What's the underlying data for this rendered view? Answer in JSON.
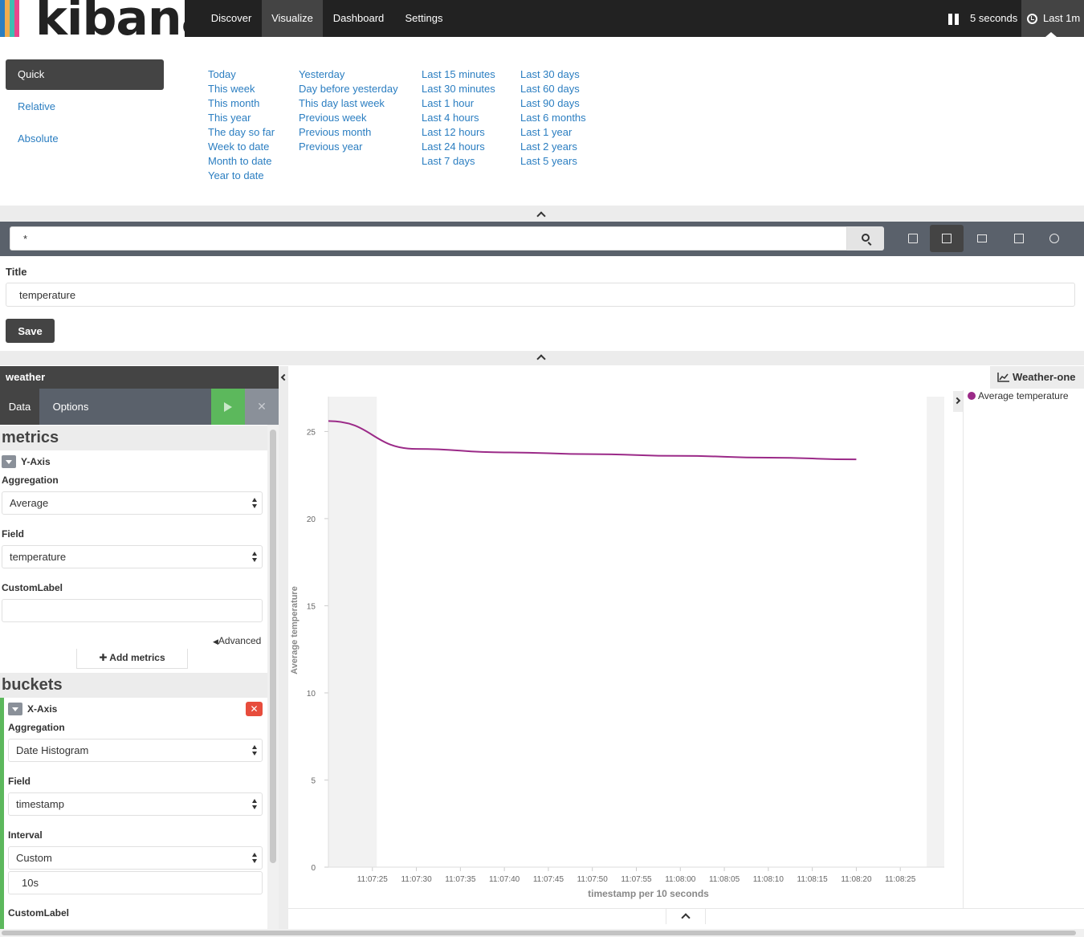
{
  "app": {
    "logo_text": "kibana",
    "logo_colors": [
      "#e8478b",
      "#3ebeb0",
      "#f0ad4e",
      "#2b7ec1"
    ]
  },
  "nav": {
    "items": [
      {
        "label": "Discover",
        "active": false
      },
      {
        "label": "Visualize",
        "active": true
      },
      {
        "label": "Dashboard",
        "active": false
      },
      {
        "label": "Settings",
        "active": false
      }
    ],
    "refresh_interval": "5 seconds",
    "time_label": "Last 1m"
  },
  "timepicker": {
    "modes": [
      "Quick",
      "Relative",
      "Absolute"
    ],
    "quick_columns": [
      [
        "Today",
        "This week",
        "This month",
        "This year",
        "The day so far",
        "Week to date",
        "Month to date",
        "Year to date"
      ],
      [
        "Yesterday",
        "Day before yesterday",
        "This day last week",
        "Previous week",
        "Previous month",
        "Previous year"
      ],
      [
        "Last 15 minutes",
        "Last 30 minutes",
        "Last 1 hour",
        "Last 4 hours",
        "Last 12 hours",
        "Last 24 hours",
        "Last 7 days"
      ],
      [
        "Last 30 days",
        "Last 60 days",
        "Last 90 days",
        "Last 6 months",
        "Last 1 year",
        "Last 2 years",
        "Last 5 years"
      ]
    ]
  },
  "search": {
    "query": "*"
  },
  "title_form": {
    "label": "Title",
    "value": "temperature",
    "save_label": "Save"
  },
  "sidebar": {
    "index_pattern": "weather",
    "tabs": [
      "Data",
      "Options"
    ],
    "metrics": {
      "heading": "metrics",
      "agg_title": "Y-Axis",
      "aggregation_label": "Aggregation",
      "aggregation_value": "Average",
      "field_label": "Field",
      "field_value": "temperature",
      "custom_label_label": "CustomLabel",
      "custom_label_value": "",
      "advanced_label": "Advanced",
      "add_metrics_label": "Add metrics"
    },
    "buckets": {
      "heading": "buckets",
      "agg_title": "X-Axis",
      "aggregation_label": "Aggregation",
      "aggregation_value": "Date Histogram",
      "field_label": "Field",
      "field_value": "timestamp",
      "interval_label": "Interval",
      "interval_value": "Custom",
      "interval_custom": "10s",
      "custom_label_label": "CustomLabel"
    }
  },
  "visualization": {
    "name": "Weather-one",
    "legend_entry": "Average temperature"
  },
  "chart_data": {
    "type": "line",
    "title": "",
    "xlabel": "timestamp per 10 seconds",
    "ylabel": "Average temperature",
    "x_ticks": [
      "11:07:25",
      "11:07:30",
      "11:07:35",
      "11:07:40",
      "11:07:45",
      "11:07:50",
      "11:07:55",
      "11:08:00",
      "11:08:05",
      "11:08:10",
      "11:08:15",
      "11:08:20",
      "11:08:25"
    ],
    "y_ticks": [
      0,
      5,
      10,
      15,
      20,
      25
    ],
    "ylim": [
      0,
      27
    ],
    "xlim_seconds": [
      "11:07:20",
      "11:08:30"
    ],
    "shaded_ranges": [
      [
        "11:07:20",
        "11:07:25.5"
      ],
      [
        "11:08:28",
        "11:08:30"
      ]
    ],
    "series": [
      {
        "name": "Average temperature",
        "color": "#9b2a88",
        "points": [
          {
            "x": "11:07:20",
            "y": 25.6
          },
          {
            "x": "11:07:30",
            "y": 24.0
          },
          {
            "x": "11:07:40",
            "y": 23.8
          },
          {
            "x": "11:07:50",
            "y": 23.7
          },
          {
            "x": "11:08:00",
            "y": 23.6
          },
          {
            "x": "11:08:10",
            "y": 23.5
          },
          {
            "x": "11:08:20",
            "y": 23.4
          }
        ]
      }
    ]
  }
}
